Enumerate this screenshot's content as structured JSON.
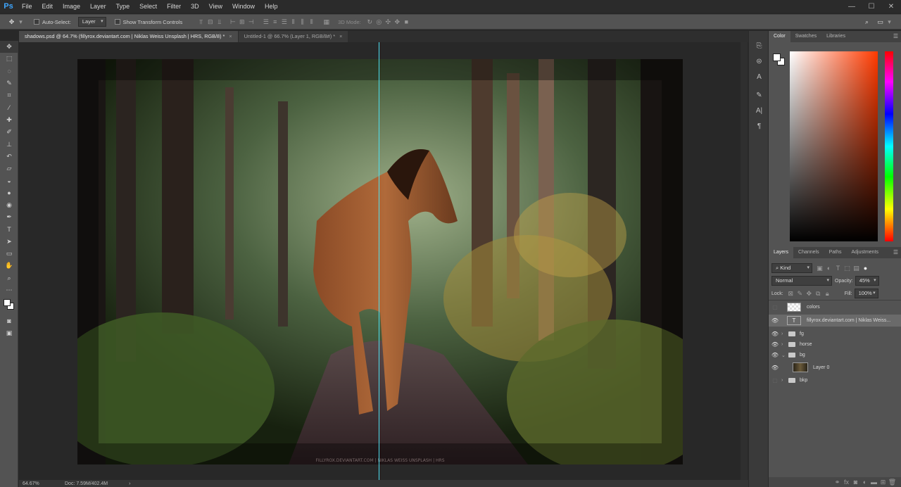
{
  "app": {
    "logo": "Ps"
  },
  "menu": [
    "File",
    "Edit",
    "Image",
    "Layer",
    "Type",
    "Select",
    "Filter",
    "3D",
    "View",
    "Window",
    "Help"
  ],
  "window_controls": [
    "—",
    "☐",
    "✕"
  ],
  "options": {
    "auto_select_label": "Auto-Select:",
    "auto_select_target": "Layer",
    "transform_label": "Show Transform Controls",
    "mode_3d_label": "3D Mode:"
  },
  "tabs": [
    {
      "label": "shadows.psd @ 64.7% (fillyrox.deviantart.com | Niklas Weiss Unsplash | HRS, RGB/8) *",
      "close": "×"
    },
    {
      "label": "Untitled-1 @ 66.7% (Layer 1, RGB/8#) *",
      "close": "×"
    }
  ],
  "canvas": {
    "watermark": "FILLYROX.DEVIANTART.COM | NIKLAS WEISS UNSPLASH | HRS"
  },
  "status": {
    "zoom": "64.67%",
    "doc": "Doc: 7.59M/402.4M",
    "arrow": "›"
  },
  "color_panel": {
    "tabs": [
      "Color",
      "Swatches",
      "Libraries"
    ]
  },
  "layers_panel": {
    "tabs": [
      "Layers",
      "Channels",
      "Paths",
      "Adjustments"
    ],
    "kind_label": "Kind",
    "blend_mode": "Normal",
    "opacity_label": "Opacity:",
    "opacity_value": "45%",
    "lock_label": "Lock:",
    "fill_label": "Fill:",
    "fill_value": "100%",
    "layers": [
      {
        "name": "colors",
        "visible": false,
        "type": "pixel"
      },
      {
        "name": "fillyrox.deviantart.com | Niklas Weiss...",
        "visible": true,
        "type": "text",
        "selected": true
      },
      {
        "name": "fg",
        "visible": true,
        "type": "group"
      },
      {
        "name": "horse",
        "visible": true,
        "type": "group"
      },
      {
        "name": "bg",
        "visible": true,
        "type": "group-open"
      },
      {
        "name": "Layer 0",
        "visible": true,
        "type": "image"
      },
      {
        "name": "bkp",
        "visible": false,
        "type": "group"
      }
    ],
    "footer_icons": [
      "link-icon",
      "fx-icon",
      "mask-icon",
      "adjustment-icon",
      "folder-icon",
      "new-layer-icon",
      "trash-icon"
    ]
  },
  "colors": {
    "panel_bg": "#535353",
    "guide": "#4ee0f0",
    "accent": "#3ea6ff"
  }
}
